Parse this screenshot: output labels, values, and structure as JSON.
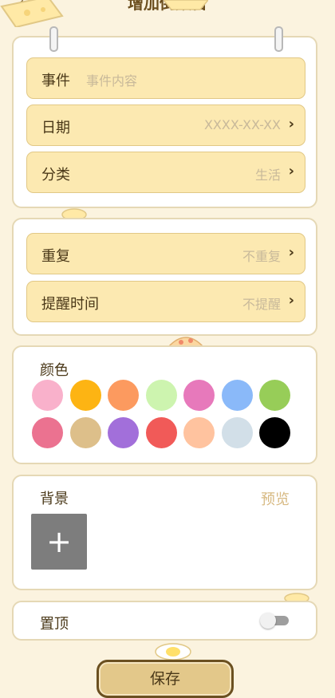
{
  "header": {
    "title": "增加倒数日",
    "back_icon": "back-arrow-icon"
  },
  "event": {
    "label": "事件",
    "placeholder": "事件内容"
  },
  "date": {
    "label": "日期",
    "value": "XXXX-XX-XX"
  },
  "category": {
    "label": "分类",
    "value": "生活"
  },
  "repeat": {
    "label": "重复",
    "value": "不重复"
  },
  "reminder": {
    "label": "提醒时间",
    "value": "不提醒"
  },
  "color": {
    "label": "颜色",
    "options": [
      "#F9B1CB",
      "#FDB413",
      "#FC9A5F",
      "#CDF4AF",
      "#E779BB",
      "#8AB9F9",
      "#97CD58",
      "#EB7290",
      "#DDBF8A",
      "#A26FDA",
      "#F15A58",
      "#FFC39F",
      "#D2DFE8",
      "#000000"
    ]
  },
  "background": {
    "label": "背景",
    "preview_label": "预览",
    "add_icon": "plus-icon"
  },
  "pin_top": {
    "label": "置顶",
    "enabled": false
  },
  "save_label": "保存"
}
